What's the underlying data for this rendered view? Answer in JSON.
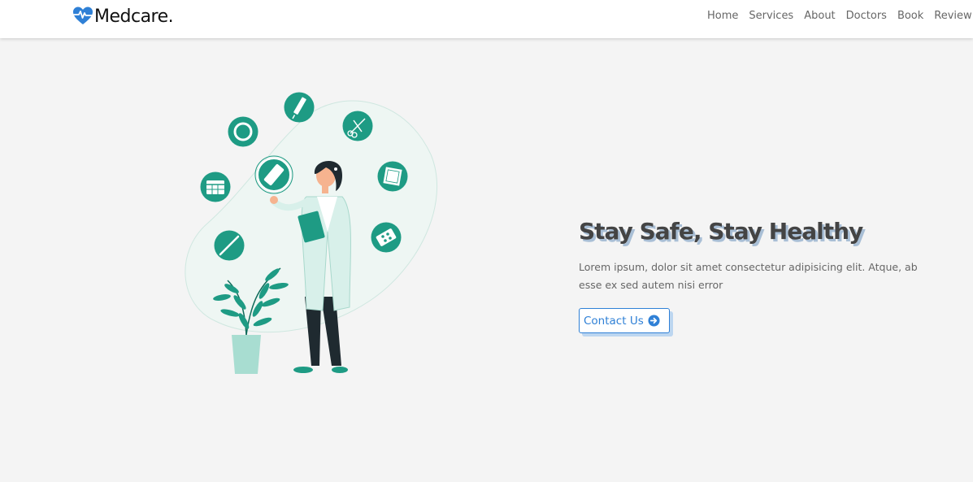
{
  "header": {
    "logo_text": "Medcare.",
    "nav": [
      "Home",
      "Services",
      "About",
      "Doctors",
      "Book",
      "Review"
    ]
  },
  "hero": {
    "title": "Stay Safe, Stay Healthy",
    "description": "Lorem ipsum, dolor sit amet consectetur adipisicing elit. Atque, ab esse ex sed autem nisi error",
    "button_label": "Contact Us"
  },
  "colors": {
    "brand_blue": "#2f80d6",
    "teal": "#1e9b84",
    "background": "#f4f4f4"
  },
  "icons": {
    "logo": "heartbeat-icon",
    "button": "arrow-right-circle-icon"
  }
}
